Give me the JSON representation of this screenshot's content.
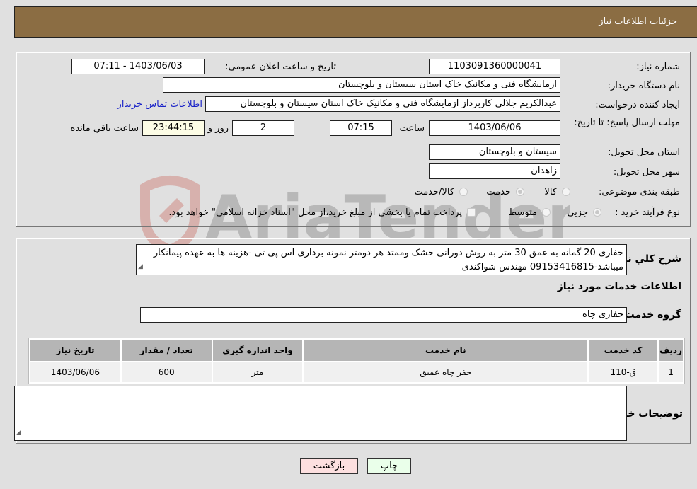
{
  "header": {
    "title": "جزئیات اطلاعات نیاز"
  },
  "fields": {
    "need_number_label": "شماره نیاز:",
    "need_number": "1103091360000041",
    "announce_label": "تاریخ و ساعت اعلان عمومي:",
    "announce_value": "1403/06/03 - 07:11",
    "buyer_org_label": "نام دستگاه خریدار:",
    "buyer_org": "ازمایشگاه فنی و مکانیک خاک استان سیستان و بلوچستان",
    "creator_label": "ایجاد کننده درخواست:",
    "creator": "عبدالکریم جلالی کاربرداز ازمایشگاه فنی و مکانیک خاک استان سیستان و بلوچستان",
    "contact_link": "اطلاعات تماس خریدار",
    "deadline_label": "مهلت ارسال پاسخ: تا تاریخ:",
    "deadline_date": "1403/06/06",
    "time_label": "ساعت",
    "deadline_time": "07:15",
    "days": "2",
    "days_label": "روز و",
    "remaining_time": "23:44:15",
    "remaining_label": "ساعت باقي مانده",
    "province_label": "استان محل تحویل:",
    "province": "سیستان و بلوچستان",
    "city_label": "شهر محل تحویل:",
    "city": "زاهدان",
    "category_label": "طبقه بندی موضوعی:",
    "category_options": [
      {
        "label": "کالا",
        "checked": false
      },
      {
        "label": "خدمت",
        "checked": true
      },
      {
        "label": "کالا/خدمت",
        "checked": false
      }
    ],
    "process_label": "نوع فرآیند خرید :",
    "process_options": [
      {
        "label": "جزيي",
        "checked": true
      },
      {
        "label": "متوسط",
        "checked": false
      }
    ],
    "payment_note": "پرداخت تمام یا بخشی از مبلغ خرید،از محل \"اسناد خزانه اسلامی\" خواهد بود."
  },
  "details": {
    "description_label": "شرح کلي نیاز:",
    "description": "حفاری 20 گمانه به عمق 30 متر به روش دورانی خشک وممتد هر دومتر نمونه برداری اس پی تی -هزینه ها به عهده پیمانکار میباشد-09153416815 مهندس شواکندی",
    "services_title": "اطلاعات خدمات مورد نیاز",
    "service_group_label": "گروه خدمت:",
    "service_group": "حفاری چاه",
    "table": {
      "headers": [
        "ردیف",
        "کد خدمت",
        "نام خدمت",
        "واحد اندازه گیری",
        "تعداد / مقدار",
        "تاریخ نیاز"
      ],
      "rows": [
        [
          "1",
          "ق-110",
          "حفر چاه عمیق",
          "متر",
          "600",
          "1403/06/06"
        ]
      ]
    },
    "buyer_notes_label": "توضیحات خریدار:",
    "buyer_notes": ""
  },
  "buttons": {
    "print": "چاپ",
    "back": "بازگشت"
  },
  "watermark": {
    "text": "AriaTender.net"
  }
}
